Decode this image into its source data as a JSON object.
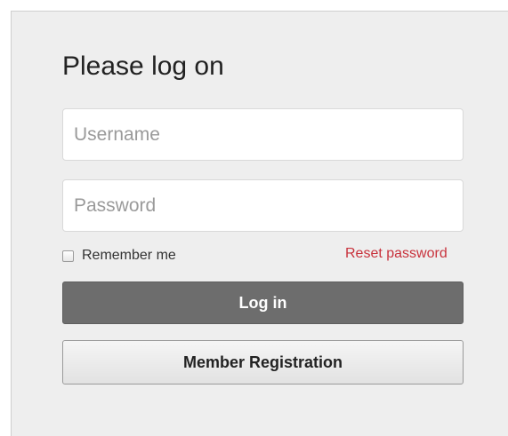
{
  "login": {
    "title": "Please log on",
    "username_placeholder": "Username",
    "password_placeholder": "Password",
    "remember_label": "Remember me",
    "remember_checked": false,
    "reset_label": "Reset password",
    "login_button": "Log in",
    "register_button": "Member Registration"
  },
  "colors": {
    "panel_background": "#eeeeee",
    "login_button": "#6d6d6d",
    "reset_link": "#c8323c"
  }
}
